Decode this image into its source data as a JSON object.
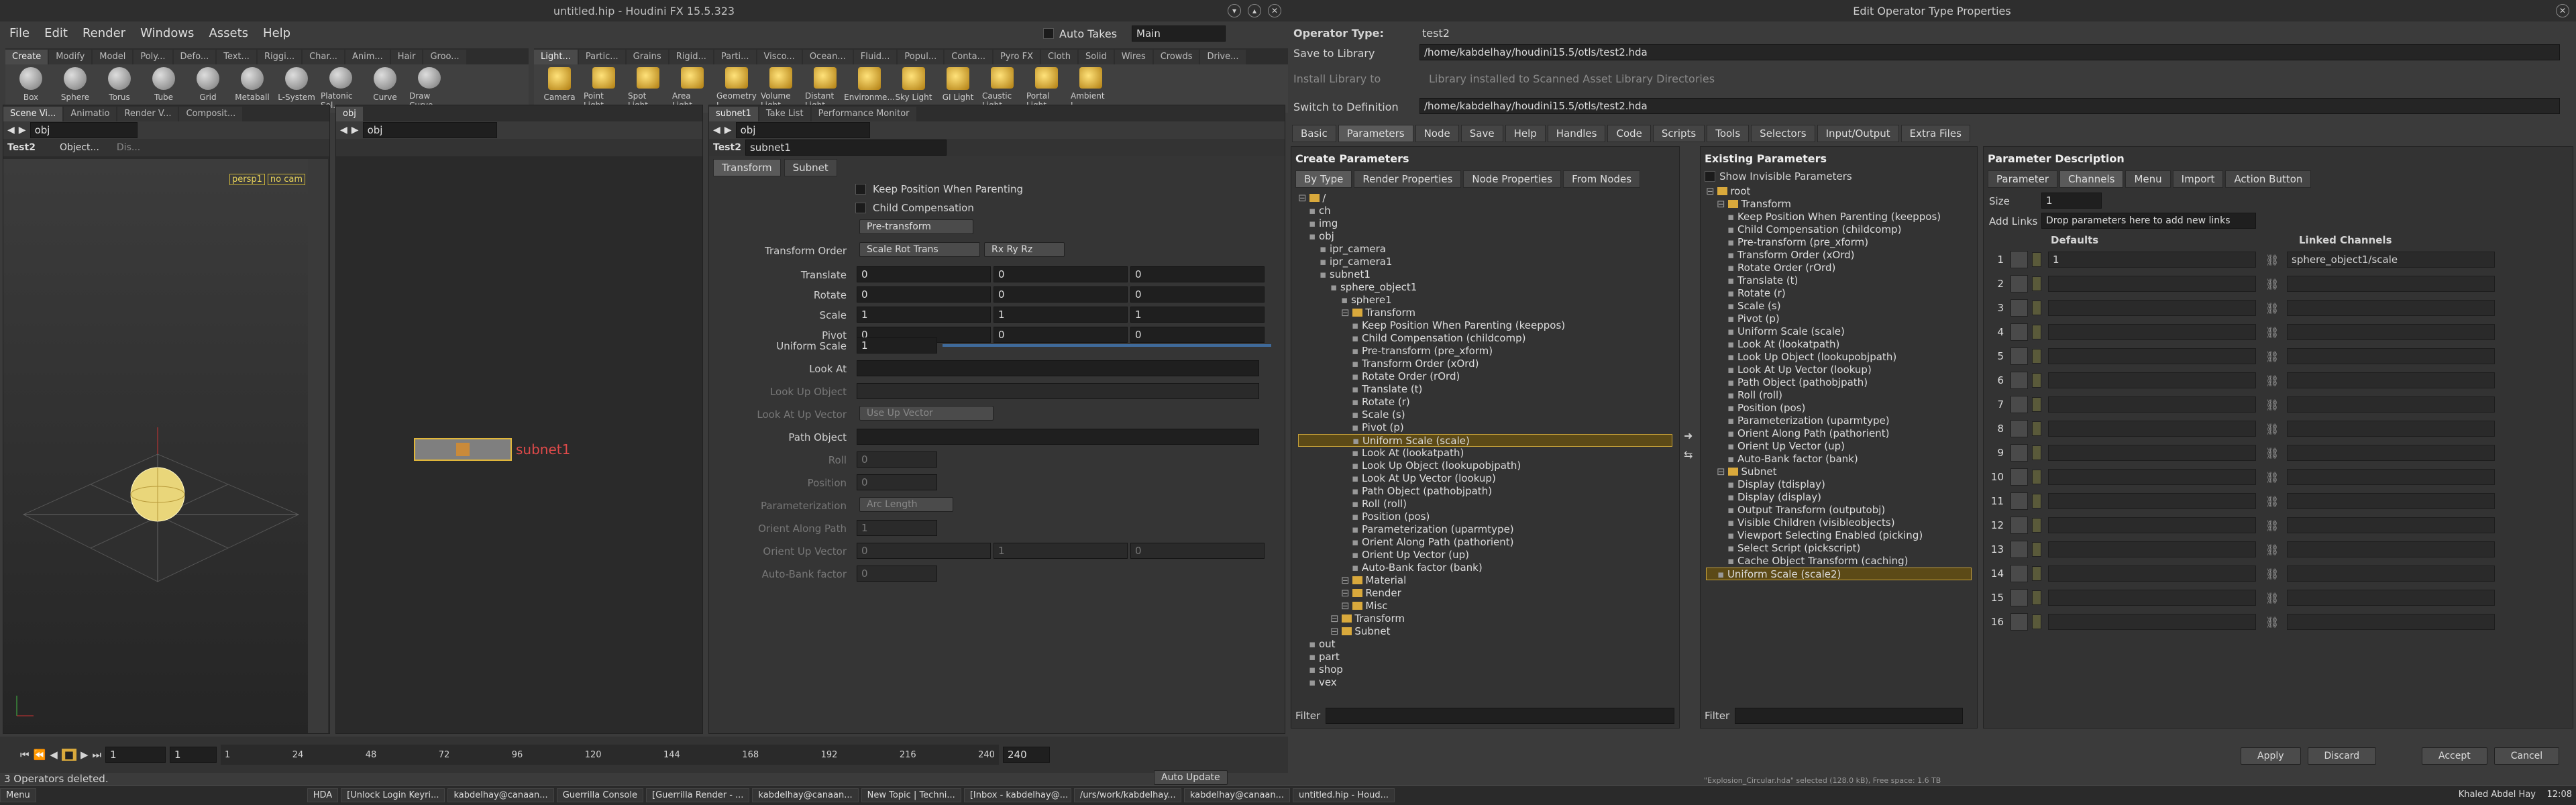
{
  "houdini": {
    "title": "untitled.hip - Houdini FX 15.5.323",
    "menu": [
      "File",
      "Edit",
      "Render",
      "Windows",
      "Assets",
      "Help"
    ],
    "auto_takes": "Auto Takes",
    "main": "Main",
    "shelf_tabs_left": [
      "Create",
      "Modify",
      "Model",
      "Poly...",
      "Defo...",
      "Text...",
      "Riggi...",
      "Char...",
      "Anim...",
      "Hair",
      "Groo..."
    ],
    "shelf_tools_left": [
      "Box",
      "Sphere",
      "Torus",
      "Tube",
      "Grid",
      "Metaball",
      "L-System",
      "Platonic Sol...",
      "Curve",
      "Draw Curve"
    ],
    "shelf_tabs_right": [
      "Light...",
      "Partic...",
      "Grains",
      "Rigid...",
      "Parti...",
      "Visco...",
      "Ocean...",
      "Fluid...",
      "Popul...",
      "Conta...",
      "Pyro FX",
      "Cloth",
      "Solid",
      "Wires",
      "Crowds",
      "Drive..."
    ],
    "shelf_tools_right": [
      "Camera",
      "Point Light",
      "Spot Light",
      "Area Light",
      "Geometry L...",
      "Volume Light",
      "Distant Light",
      "Environme...",
      "Sky Light",
      "GI Light",
      "Caustic Light",
      "Portal Light",
      "Ambient L..."
    ],
    "pane_tabs_1": [
      "Scene Vi...",
      "Animatio",
      "Render V...",
      "Composit..."
    ],
    "pane_tabs_2": [
      "obj"
    ],
    "pane_tabs_3": [
      "subnet1",
      "Take List",
      "Performance Monitor"
    ],
    "path": "obj",
    "viewport": {
      "camera": "persp1",
      "cam2": "no cam",
      "node_label": "Test2",
      "obj_label": "Object...",
      "dis": "Dis..."
    },
    "network": {
      "node": "subnet1"
    },
    "params": {
      "node_type": "Test2",
      "node_name": "subnet1",
      "tabs": [
        "Transform",
        "Subnet"
      ],
      "keep_pos": "Keep Position When Parenting",
      "child_comp": "Child Compensation",
      "pretransform": "Pre-transform",
      "xform_order_label": "Transform Order",
      "xform_order": "Scale Rot Trans",
      "rot_order": "Rx Ry Rz",
      "rows": [
        {
          "label": "Translate",
          "v": [
            "0",
            "0",
            "0"
          ]
        },
        {
          "label": "Rotate",
          "v": [
            "0",
            "0",
            "0"
          ]
        },
        {
          "label": "Scale",
          "v": [
            "1",
            "1",
            "1"
          ]
        },
        {
          "label": "Pivot",
          "v": [
            "0",
            "0",
            "0"
          ]
        }
      ],
      "uniform_scale_label": "Uniform Scale",
      "uniform_scale": "1",
      "look_at": "Look At",
      "look_up": "Look Up Object",
      "look_at_up": "Look At Up Vector",
      "use_up": "Use Up Vector",
      "path_obj": "Path Object",
      "roll": "Roll",
      "roll_v": "0",
      "position": "Position",
      "position_v": "0",
      "param": "Parameterization",
      "arc": "Arc Length",
      "orient_path": "Orient Along Path",
      "orient_path_v": "1",
      "orient_up": "Orient Up Vector",
      "orient_up_v": [
        "0",
        "1",
        "0"
      ],
      "autobank": "Auto-Bank factor",
      "autobank_v": "0"
    },
    "timeline": {
      "frame": "1",
      "start": "1",
      "end": "240",
      "ticks": [
        "1",
        "24",
        "48",
        "72",
        "96",
        "120",
        "144",
        "168",
        "192",
        "216",
        "240"
      ]
    },
    "status": "3 Operators deleted.",
    "auto_update": "Auto Update"
  },
  "dialog": {
    "title": "Edit Operator Type Properties",
    "op_type_label": "Operator Type:",
    "op_type": "test2",
    "save_to": "Save to Library",
    "save_path": "/home/kabdelhay/houdini15.5/otls/test2.hda",
    "install": "Install Library to",
    "install_v": "Library installed to Scanned Asset Library Directories",
    "switch": "Switch to Definition",
    "switch_v": "/home/kabdelhay/houdini15.5/otls/test2.hda",
    "tabs": [
      "Basic",
      "Parameters",
      "Node",
      "Save",
      "Help",
      "Handles",
      "Code",
      "Scripts",
      "Tools",
      "Selectors",
      "Input/Output",
      "Extra Files"
    ],
    "create_params": "Create Parameters",
    "cp_tabs": [
      "By Type",
      "Render Properties",
      "Node Properties",
      "From Nodes"
    ],
    "cp_tree": [
      {
        "d": 0,
        "t": "/"
      },
      {
        "d": 1,
        "t": "ch"
      },
      {
        "d": 1,
        "t": "img"
      },
      {
        "d": 1,
        "t": "obj"
      },
      {
        "d": 2,
        "t": "ipr_camera"
      },
      {
        "d": 2,
        "t": "ipr_camera1"
      },
      {
        "d": 2,
        "t": "subnet1"
      },
      {
        "d": 3,
        "t": "sphere_object1"
      },
      {
        "d": 4,
        "t": "sphere1"
      },
      {
        "d": 4,
        "t": "Transform"
      },
      {
        "d": 5,
        "t": "Keep Position When Parenting (keeppos)"
      },
      {
        "d": 5,
        "t": "Child Compensation (childcomp)"
      },
      {
        "d": 5,
        "t": "Pre-transform (pre_xform)"
      },
      {
        "d": 5,
        "t": "Transform Order (xOrd)"
      },
      {
        "d": 5,
        "t": "Rotate Order (rOrd)"
      },
      {
        "d": 5,
        "t": "Translate (t)"
      },
      {
        "d": 5,
        "t": "Rotate (r)"
      },
      {
        "d": 5,
        "t": "Scale (s)"
      },
      {
        "d": 5,
        "t": "Pivot (p)"
      },
      {
        "d": 5,
        "t": "Uniform Scale (scale)",
        "sel": true
      },
      {
        "d": 5,
        "t": "Look At (lookatpath)"
      },
      {
        "d": 5,
        "t": "Look Up Object (lookupobjpath)"
      },
      {
        "d": 5,
        "t": "Look At Up Vector (lookup)"
      },
      {
        "d": 5,
        "t": "Path Object (pathobjpath)"
      },
      {
        "d": 5,
        "t": "Roll (roll)"
      },
      {
        "d": 5,
        "t": "Position (pos)"
      },
      {
        "d": 5,
        "t": "Parameterization (uparmtype)"
      },
      {
        "d": 5,
        "t": "Orient Along Path (pathorient)"
      },
      {
        "d": 5,
        "t": "Orient Up Vector (up)"
      },
      {
        "d": 5,
        "t": "Auto-Bank factor (bank)"
      },
      {
        "d": 4,
        "t": "Material"
      },
      {
        "d": 4,
        "t": "Render"
      },
      {
        "d": 4,
        "t": "Misc"
      },
      {
        "d": 3,
        "t": "Transform"
      },
      {
        "d": 3,
        "t": "Subnet"
      },
      {
        "d": 1,
        "t": "out"
      },
      {
        "d": 1,
        "t": "part"
      },
      {
        "d": 1,
        "t": "shop"
      },
      {
        "d": 1,
        "t": "vex"
      }
    ],
    "filter": "Filter",
    "existing": "Existing Parameters",
    "show_invis": "Show Invisible Parameters",
    "ex_tree": [
      {
        "d": 0,
        "t": "root"
      },
      {
        "d": 1,
        "t": "Transform"
      },
      {
        "d": 2,
        "t": "Keep Position When Parenting (keeppos)"
      },
      {
        "d": 2,
        "t": "Child Compensation (childcomp)"
      },
      {
        "d": 2,
        "t": "Pre-transform (pre_xform)"
      },
      {
        "d": 2,
        "t": "Transform Order (xOrd)"
      },
      {
        "d": 2,
        "t": "Rotate Order (rOrd)"
      },
      {
        "d": 2,
        "t": "Translate (t)"
      },
      {
        "d": 2,
        "t": "Rotate (r)"
      },
      {
        "d": 2,
        "t": "Scale (s)"
      },
      {
        "d": 2,
        "t": "Pivot (p)"
      },
      {
        "d": 2,
        "t": "Uniform Scale (scale)"
      },
      {
        "d": 2,
        "t": "Look At (lookatpath)"
      },
      {
        "d": 2,
        "t": "Look Up Object (lookupobjpath)"
      },
      {
        "d": 2,
        "t": "Look At Up Vector (lookup)"
      },
      {
        "d": 2,
        "t": "Path Object (pathobjpath)"
      },
      {
        "d": 2,
        "t": "Roll (roll)"
      },
      {
        "d": 2,
        "t": "Position (pos)"
      },
      {
        "d": 2,
        "t": "Parameterization (uparmtype)"
      },
      {
        "d": 2,
        "t": "Orient Along Path (pathorient)"
      },
      {
        "d": 2,
        "t": "Orient Up Vector (up)"
      },
      {
        "d": 2,
        "t": "Auto-Bank factor (bank)"
      },
      {
        "d": 1,
        "t": "Subnet"
      },
      {
        "d": 2,
        "t": "Display (tdisplay)"
      },
      {
        "d": 2,
        "t": "Display (display)"
      },
      {
        "d": 2,
        "t": "Output Transform (outputobj)"
      },
      {
        "d": 2,
        "t": "Visible Children (visibleobjects)"
      },
      {
        "d": 2,
        "t": "Viewport Selecting Enabled (picking)"
      },
      {
        "d": 2,
        "t": "Select Script (pickscript)"
      },
      {
        "d": 2,
        "t": "Cache Object Transform (caching)"
      },
      {
        "d": 1,
        "t": "Uniform Scale (scale2)",
        "sel": true
      }
    ],
    "desc": "Parameter Description",
    "desc_tabs": [
      "Parameter",
      "Channels",
      "Menu",
      "Import",
      "Action Button"
    ],
    "size_label": "Size",
    "size": "1",
    "add_links": "Add Links",
    "drop": "Drop parameters here to add new links",
    "defaults": "Defaults",
    "linked": "Linked Channels",
    "link_rows": [
      {
        "n": "1",
        "def": "1",
        "link": "sphere_object1/scale"
      },
      {
        "n": "2"
      },
      {
        "n": "3"
      },
      {
        "n": "4"
      },
      {
        "n": "5"
      },
      {
        "n": "6"
      },
      {
        "n": "7"
      },
      {
        "n": "8"
      },
      {
        "n": "9"
      },
      {
        "n": "10"
      },
      {
        "n": "11"
      },
      {
        "n": "12"
      },
      {
        "n": "13"
      },
      {
        "n": "14"
      },
      {
        "n": "15"
      },
      {
        "n": "16"
      }
    ],
    "apply": "Apply",
    "discard": "Discard",
    "accept": "Accept",
    "cancel": "Cancel"
  },
  "taskbar": {
    "menu": "Menu",
    "msg": "\"Explosion_Circular.hda\" selected (128.0 kB), Free space: 1.6 TB",
    "items": [
      "HDA",
      "[Unlock Login Keyri...",
      "kabdelhay@canaan...",
      "Guerrilla Console",
      "[Guerrilla Render - ...",
      "kabdelhay@canaan...",
      "New Topic | Techni...",
      "[Inbox - kabdelhay@...",
      "/urs/work/kabdelhay...",
      "kabdelhay@canaan...",
      "untitled.hip - Houd..."
    ],
    "user": "Khaled Abdel Hay",
    "time": "12:08"
  }
}
